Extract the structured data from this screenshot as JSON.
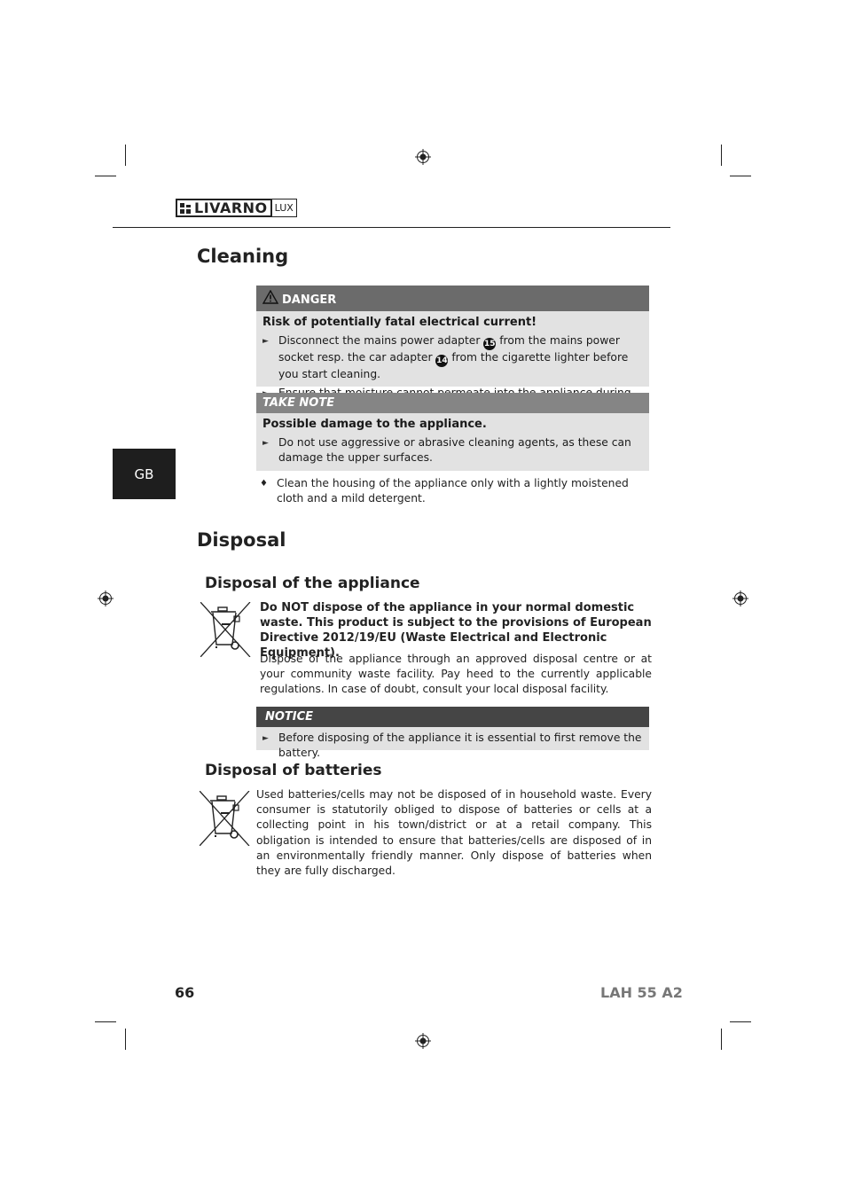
{
  "header": {
    "brand": "LIVARNO",
    "brand_suffix": "LUX"
  },
  "language_tab": "GB",
  "cleaning": {
    "title": "Cleaning",
    "danger": {
      "label": "DANGER",
      "icon": "warning-triangle-icon",
      "lead": "Risk of potentially fatal electrical current!",
      "items": [
        {
          "parts": [
            "Disconnect the mains power adapter ",
            "15",
            " from the mains power socket resp. the car adapter ",
            "14",
            " from the cigarette lighter before you start cleaning."
          ]
        },
        {
          "parts": [
            "Ensure that moisture cannot permeate into the appliance during cleaning."
          ]
        }
      ]
    },
    "take_note": {
      "label": "TAKE NOTE",
      "lead": "Possible damage to the appliance.",
      "items": [
        "Do not use aggressive or abrasive cleaning agents, as these can damage the upper surfaces."
      ]
    },
    "instruction": "Clean the housing of the appliance only with a lightly moistened cloth and a mild detergent."
  },
  "disposal": {
    "title": "Disposal",
    "appliance": {
      "title": "Disposal of the appliance",
      "icon": "crossed-out-bin-icon",
      "bold_text": "Do NOT dispose of the appliance in your normal domestic waste. This product is subject to the provisions of European Directive 2012/19/EU (Waste Electrical and Electronic Equipment).",
      "text": "Dispose of the appliance through an approved disposal centre or at your community waste facility. Pay heed to the currently applicable regulations. In case of doubt, consult your local disposal facility.",
      "notice": {
        "label": "NOTICE",
        "items": [
          "Before disposing of the appliance it is essential to first remove the battery."
        ]
      }
    },
    "batteries": {
      "title": "Disposal of batteries",
      "icon": "crossed-out-bin-icon",
      "text": "Used batteries/cells may not be disposed of in household waste. Every consumer is statutorily obliged to dispose of batteries or cells at a collecting point in his town/district or at a retail company. This obligation is intended to ensure that batteries/cells are disposed of in an environmentally friendly manner. Only dispose of batteries when they are fully discharged."
    }
  },
  "footer": {
    "page_number": "66",
    "model": "LAH 55 A2"
  },
  "colors": {
    "danger_header": "#6b6b6b",
    "take_note_header": "#858585",
    "notice_header": "#454545",
    "box_body": "#e2e2e2",
    "language_tab": "#1e1e1e",
    "model_text": "#777777"
  }
}
